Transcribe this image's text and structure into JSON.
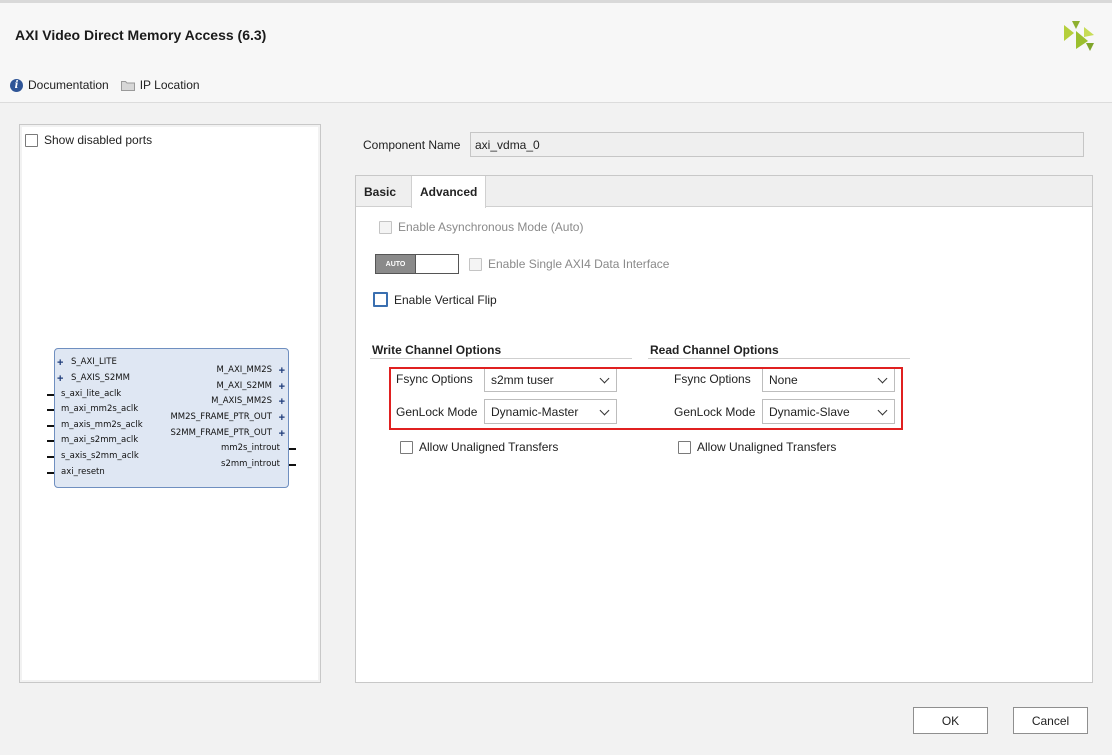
{
  "window": {
    "title": "AXI Video Direct Memory Access (6.3)"
  },
  "toolbar": {
    "documentation_label": "Documentation",
    "ip_location_label": "IP Location"
  },
  "left_panel": {
    "show_disabled_ports_label": "Show disabled ports",
    "show_disabled_ports_checked": false,
    "block": {
      "left_ports": [
        "S_AXI_LITE",
        "S_AXIS_S2MM",
        "s_axi_lite_aclk",
        "m_axi_mm2s_aclk",
        "m_axis_mm2s_aclk",
        "m_axi_s2mm_aclk",
        "s_axis_s2mm_aclk",
        "axi_resetn"
      ],
      "right_ports": [
        "M_AXI_MM2S",
        "M_AXI_S2MM",
        "M_AXIS_MM2S",
        "MM2S_FRAME_PTR_OUT",
        "S2MM_FRAME_PTR_OUT",
        "mm2s_introut",
        "s2mm_introut"
      ]
    }
  },
  "component": {
    "label": "Component Name",
    "value": "axi_vdma_0"
  },
  "tabs": [
    {
      "label": "Basic",
      "active": false
    },
    {
      "label": "Advanced",
      "active": true
    }
  ],
  "advanced": {
    "async_mode_label": "Enable Asynchronous Mode (Auto)",
    "auto_toggle_label": "AUTO",
    "single_axi4_label": "Enable Single AXI4 Data Interface",
    "vertical_flip_label": "Enable Vertical Flip",
    "write_channel": {
      "title": "Write Channel Options",
      "fsync_label": "Fsync Options",
      "fsync_value": "s2mm tuser",
      "genlock_label": "GenLock Mode",
      "genlock_value": "Dynamic-Master",
      "unaligned_label": "Allow Unaligned Transfers"
    },
    "read_channel": {
      "title": "Read Channel Options",
      "fsync_label": "Fsync Options",
      "fsync_value": "None",
      "genlock_label": "GenLock Mode",
      "genlock_value": "Dynamic-Slave",
      "unaligned_label": "Allow Unaligned Transfers"
    }
  },
  "buttons": {
    "ok": "OK",
    "cancel": "Cancel"
  },
  "colors": {
    "highlight_box": "#e02020",
    "logo": "#9bbf2e",
    "block_fill": "#dfe7f3"
  }
}
